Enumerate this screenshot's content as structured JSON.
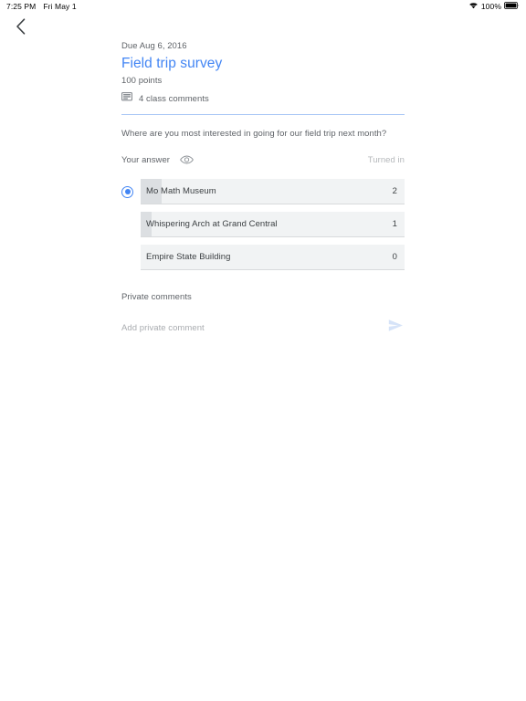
{
  "status_bar": {
    "time": "7:25 PM",
    "date": "Fri May 1",
    "battery_percent": "100%",
    "wifi_icon": "wifi-icon",
    "battery_icon": "battery-full-icon"
  },
  "nav": {
    "back_icon": "chevron-left-icon"
  },
  "assignment": {
    "due": "Due Aug 6, 2016",
    "title": "Field trip survey",
    "points": "100 points",
    "comments_icon": "class-comments-icon",
    "class_comments": "4 class comments"
  },
  "question": {
    "text": "Where are you most interested in going for our field trip next month?",
    "answer_label": "Your answer",
    "visibility_icon": "eye-icon",
    "status": "Turned in"
  },
  "chart_data": {
    "type": "bar",
    "title": "Where are you most interested in going for our field trip next month?",
    "categories": [
      "Mo Math Museum",
      "Whispering Arch at Grand Central",
      "Empire State Building"
    ],
    "values": [
      2,
      1,
      0
    ],
    "selected_index": 0,
    "xlabel": "",
    "ylabel": "",
    "orientation": "horizontal",
    "max_value": 2,
    "bar_scale_percent": [
      8,
      4,
      0
    ],
    "legend": "none",
    "grid": false
  },
  "private_comments": {
    "heading": "Private comments",
    "input_value": "",
    "input_placeholder": "Add private comment",
    "send_icon": "send-icon"
  },
  "colors": {
    "accent_blue": "#4285f4",
    "divider_blue": "#a9c7f5",
    "bar_track": "#f1f3f4",
    "bar_fill": "#dcdfe2",
    "text_secondary": "#5f6368",
    "send_icon": "#d6e3f8"
  }
}
